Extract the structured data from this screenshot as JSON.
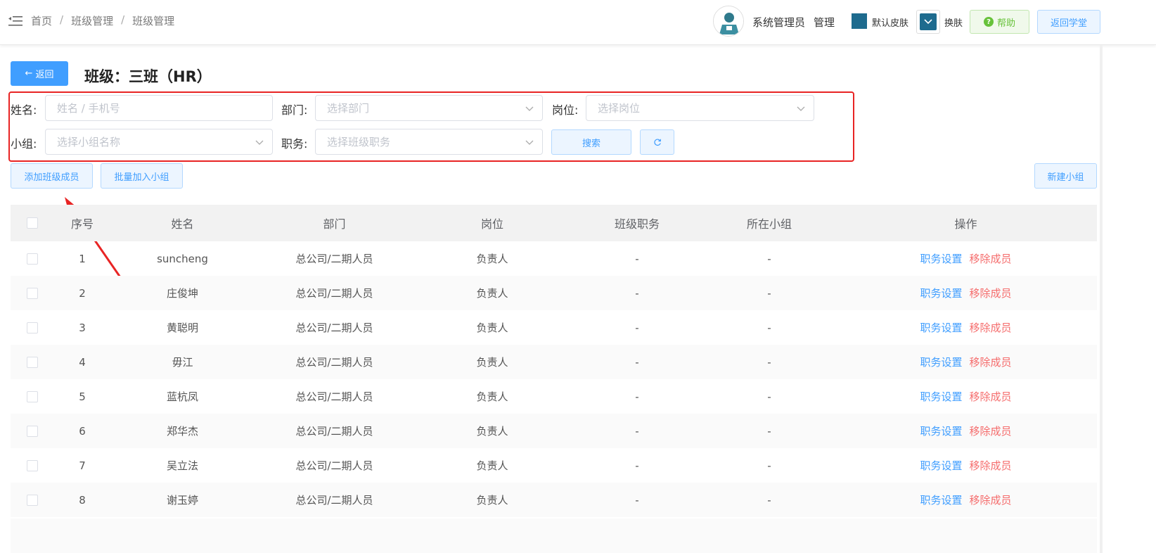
{
  "header": {
    "breadcrumb": [
      "首页",
      "班级管理",
      "班级管理"
    ],
    "breadcrumb_sep": "/",
    "username": "系统管理员",
    "admin_link": "管理",
    "skin_label": "默认皮肤",
    "skin_change": "换肤",
    "skin_color": "#1e6b8e",
    "help_label": "帮助",
    "back_study_label": "返回学堂"
  },
  "title_row": {
    "back_label": "返回",
    "page_title": "班级：三班（HR）"
  },
  "filters": {
    "name_label": "姓名:",
    "name_placeholder": "姓名 / 手机号",
    "dept_label": "部门:",
    "dept_placeholder": "选择部门",
    "post_label": "岗位:",
    "post_placeholder": "选择岗位",
    "group_label": "小组:",
    "group_placeholder": "选择小组名称",
    "duty_label": "职务:",
    "duty_placeholder": "选择班级职务",
    "search_label": "搜索"
  },
  "actions": {
    "add_member": "添加班级成员",
    "batch_add_group": "批量加入小组",
    "new_group": "新建小组"
  },
  "table": {
    "headers": [
      "序号",
      "姓名",
      "部门",
      "岗位",
      "班级职务",
      "所在小组",
      "操作"
    ],
    "op_set": "职务设置",
    "op_remove": "移除成员",
    "rows": [
      {
        "idx": "1",
        "name": "suncheng",
        "dept": "总公司/二期人员",
        "post": "负责人",
        "duty": "-",
        "group": "-"
      },
      {
        "idx": "2",
        "name": "庄俊坤",
        "dept": "总公司/二期人员",
        "post": "负责人",
        "duty": "-",
        "group": "-"
      },
      {
        "idx": "3",
        "name": "黄聪明",
        "dept": "总公司/二期人员",
        "post": "负责人",
        "duty": "-",
        "group": "-"
      },
      {
        "idx": "4",
        "name": "毋江",
        "dept": "总公司/二期人员",
        "post": "负责人",
        "duty": "-",
        "group": "-"
      },
      {
        "idx": "5",
        "name": "蓝杭凤",
        "dept": "总公司/二期人员",
        "post": "负责人",
        "duty": "-",
        "group": "-"
      },
      {
        "idx": "6",
        "name": "郑华杰",
        "dept": "总公司/二期人员",
        "post": "负责人",
        "duty": "-",
        "group": "-"
      },
      {
        "idx": "7",
        "name": "吴立法",
        "dept": "总公司/二期人员",
        "post": "负责人",
        "duty": "-",
        "group": "-"
      },
      {
        "idx": "8",
        "name": "谢玉婷",
        "dept": "总公司/二期人员",
        "post": "负责人",
        "duty": "-",
        "group": "-"
      }
    ]
  },
  "colors": {
    "primary": "#409eff",
    "danger": "#f56c6c",
    "success": "#67c23a",
    "annotation": "#e82424"
  }
}
